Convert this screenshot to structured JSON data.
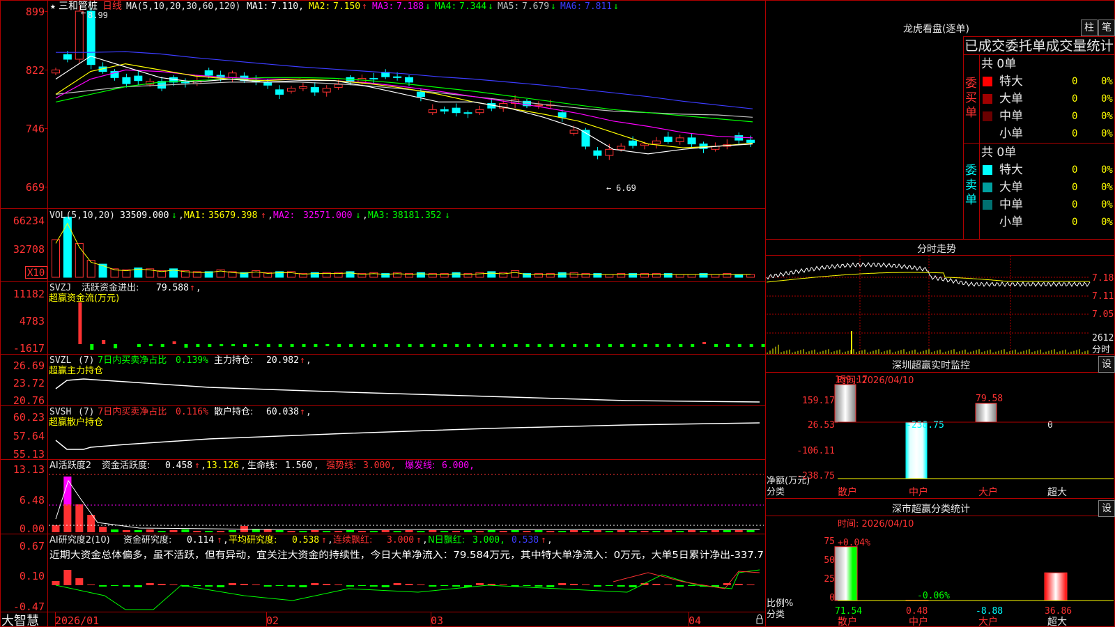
{
  "colors": {
    "up": "#ff3232",
    "down": "#00ffff",
    "grid": "#b00000",
    "ma1": "#ffffff",
    "ma2": "#ffff00",
    "ma3": "#ff00ff",
    "ma4": "#00ff00",
    "ma5": "#c0c0c0",
    "ma6": "#3c3cff",
    "text": "#e6e6e6",
    "green": "#00ff00"
  },
  "main": {
    "title_star": "★",
    "name": "三和管桩",
    "period": "日线",
    "ma_label": "MA(5,10,20,30,60,120)",
    "ma": [
      {
        "label": "MA1:",
        "value": "7.110,",
        "arrow": ""
      },
      {
        "label": "MA2:",
        "value": "7.150",
        "arrow": "↑"
      },
      {
        "label": "MA3:",
        "value": "7.188",
        "arrow": "↓"
      },
      {
        "label": "MA4:",
        "value": "7.344",
        "arrow": "↓"
      },
      {
        "label": "MA5:",
        "value": "7.679",
        "arrow": "↓"
      },
      {
        "label": "MA6:",
        "value": "7.811",
        "arrow": "↓"
      }
    ],
    "y_ticks": [
      "899",
      "822",
      "746",
      "669"
    ],
    "high_mark": "8.99",
    "low_mark": "6.69"
  },
  "vol": {
    "label": "VOL(5,10,20)",
    "value": "33509.000",
    "value_arrow": "↓",
    "ma": [
      {
        "label": "MA1:",
        "value": "35679.398",
        "arrow": "↑"
      },
      {
        "label": "MA2:",
        "value": "32571.000",
        "arrow": "↓"
      },
      {
        "label": "MA3:",
        "value": "38181.352",
        "arrow": "↓"
      }
    ],
    "y_ticks": [
      "66234",
      "32708"
    ],
    "unit": "X10"
  },
  "svzj": {
    "label": "SVZJ",
    "sub_label": "活跃资金进出:",
    "value": "79.588",
    "arrow": "↑",
    "comma": ",",
    "title2": "超赢资金流(万元)",
    "y_ticks": [
      "11182",
      "4783",
      "-1617"
    ]
  },
  "svzl": {
    "label": "SVZL",
    "param": "(7)",
    "t1": "7日内买卖净占比",
    "v1": "0.139%",
    "t2": "主力持仓:",
    "v2": "20.982",
    "arrow": "↑",
    "comma": ",",
    "title2": "超赢主力持仓",
    "y_ticks": [
      "26.69",
      "23.72",
      "20.76"
    ]
  },
  "svsh": {
    "label": "SVSH",
    "param": "(7)",
    "t1": "7日内买卖净占比",
    "v1": "0.116%",
    "t2": "散户持仓:",
    "v2": "60.038",
    "arrow": "↑",
    "comma": ",",
    "title2": "超赢散户持仓",
    "y_ticks": [
      "60.23",
      "57.64",
      "55.13"
    ]
  },
  "ai1": {
    "label": "AI活跃度2",
    "t1": "资金活跃度:",
    "v1": "0.458",
    "a1": "↑",
    "comma": ",",
    "v2": "13.126",
    "comma2": ",",
    "t3": "生命线:",
    "v3": "1.560",
    "comma3": ",",
    "t4": "强势线:",
    "v4": "3.000,",
    "t5": "爆发线:",
    "v5": "6.000,",
    "y_ticks": [
      "13.13",
      "6.48",
      "0.00"
    ]
  },
  "ai2": {
    "label": "AI研究度2(10)",
    "t1": "资金研究度:",
    "v1": "0.114",
    "a1": "↑",
    "comma": ",",
    "t2": "平均研究度:",
    "v2": "0.538",
    "a2": "↑",
    "comma2": ",",
    "t3": "连续飘红:",
    "v3": "3.000",
    "a3": "↑",
    "comma3": ",",
    "t4": "N日飘红:",
    "v4": "3.000,",
    "v5": "0.538",
    "a5": "↑",
    "comma5": ",",
    "comment": "近期大资金总体偏多，虽不活跃，但有异动，宜关注大资金的持续性，今日大单净流入：79.584万元，其中特大单净流入：0万元，大单5日累计净出-337.7",
    "y_ticks": [
      "0.67",
      "0.10",
      "-0.47"
    ]
  },
  "xaxis": {
    "labels": [
      "2026/01",
      "02",
      "03",
      "04"
    ]
  },
  "brand": "大智慧",
  "dragon": {
    "title": "龙虎看盘(逐单)",
    "btn1": "柱",
    "btn2": "笔",
    "header": "已成交委托单成交量统计",
    "buy_side": "委买单",
    "sell_side": "委卖单",
    "buy_total": "共 0单",
    "sell_total": "共 0单",
    "buy_rows": [
      {
        "label": "特大",
        "count": "0",
        "pct": "0%",
        "color": "#ff0000"
      },
      {
        "label": "大单",
        "count": "0",
        "pct": "0%",
        "color": "#a00000"
      },
      {
        "label": "中单",
        "count": "0",
        "pct": "0%",
        "color": "#6a0000"
      },
      {
        "label": "小单",
        "count": "0",
        "pct": "0%",
        "color": ""
      }
    ],
    "sell_rows": [
      {
        "label": "特大",
        "count": "0",
        "pct": "0%",
        "color": "#00ffff"
      },
      {
        "label": "大单",
        "count": "0",
        "pct": "0%",
        "color": "#00a0a0"
      },
      {
        "label": "中单",
        "count": "0",
        "pct": "0%",
        "color": "#007070"
      },
      {
        "label": "小单",
        "count": "0",
        "pct": "0%",
        "color": ""
      }
    ]
  },
  "intraday": {
    "title": "分时走势",
    "y_ticks": [
      "7.18",
      "7.11",
      "7.05"
    ],
    "vol_top": "2612",
    "vol_unit": "分时"
  },
  "monitor": {
    "title": "深圳超赢实时监控",
    "btn": "设",
    "time": "时间: 2026/04/10",
    "y_ticks": [
      "159.17",
      "26.53",
      "-106.11",
      "-238.75"
    ],
    "axis_title1": "净额(万元)",
    "axis_title2": "分类",
    "categories": [
      "散户",
      "中户",
      "大户",
      "超大"
    ],
    "values": [
      159.17,
      -238.75,
      79.58,
      0
    ],
    "value_labels": [
      "159.17",
      "-238.75",
      "79.58",
      "0"
    ]
  },
  "classify": {
    "title": "深市超赢分类统计",
    "btn": "设",
    "time": "时间: 2026/04/10",
    "y_ticks": [
      "75",
      "50",
      "25",
      "0"
    ],
    "axis_title1": "比例%",
    "axis_title2": "分类",
    "categories": [
      "散户",
      "中户",
      "大户",
      "超大"
    ],
    "values": [
      71.54,
      0.48,
      -8.88,
      36.86
    ],
    "value_labels": [
      "71.54",
      "0.48",
      "-8.88",
      "36.86"
    ],
    "top_labels": [
      "+0.04%",
      "-0.06%"
    ]
  }
}
